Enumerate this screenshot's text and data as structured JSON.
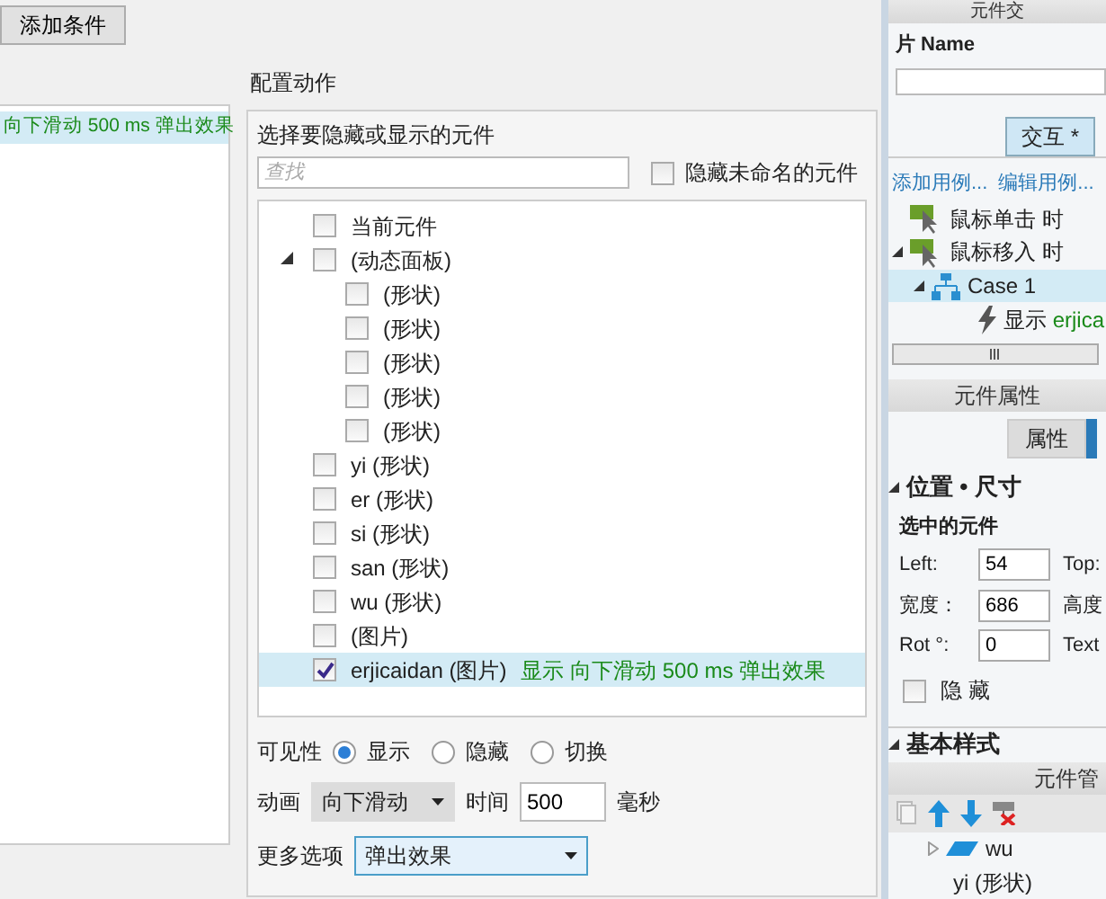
{
  "conditions_button": "添加条件",
  "case_list": {
    "rows": [
      {
        "text": "向下滑动 500 ms 弹出效果",
        "selected": true
      }
    ]
  },
  "configure": {
    "title": "配置动作",
    "group_label": "选择要隐藏或显示的元件",
    "search": {
      "placeholder": "查找"
    },
    "hide_unnamed": {
      "label": "隐藏未命名的元件",
      "checked": false
    },
    "tree": [
      {
        "label": "当前元件",
        "checked": false,
        "selected": false
      },
      {
        "label": "(动态面板)",
        "checked": false,
        "selected": false,
        "expanded": true,
        "children": [
          {
            "label": "(形状)",
            "checked": false,
            "selected": false
          },
          {
            "label": "(形状)",
            "checked": false,
            "selected": false
          },
          {
            "label": "(形状)",
            "checked": false,
            "selected": false
          },
          {
            "label": "(形状)",
            "checked": false,
            "selected": false
          },
          {
            "label": "(形状)",
            "checked": false,
            "selected": false
          }
        ]
      },
      {
        "label": "yi (形状)",
        "checked": false,
        "selected": false
      },
      {
        "label": "er (形状)",
        "checked": false,
        "selected": false
      },
      {
        "label": "si (形状)",
        "checked": false,
        "selected": false
      },
      {
        "label": "san (形状)",
        "checked": false,
        "selected": false
      },
      {
        "label": "wu (形状)",
        "checked": false,
        "selected": false
      },
      {
        "label": "(图片)",
        "checked": false,
        "selected": false
      },
      {
        "label": "erjicaidan (图片)",
        "checked": true,
        "selected": true,
        "action": "显示 向下滑动 500 ms 弹出效果"
      }
    ],
    "visibility": {
      "label": "可见性",
      "options": [
        {
          "label": "显示",
          "selected": true
        },
        {
          "label": "隐藏",
          "selected": false
        },
        {
          "label": "切换",
          "selected": false
        }
      ]
    },
    "animation": {
      "label": "动画",
      "value": "向下滑动",
      "time_label": "时间",
      "time_value": "500",
      "unit": "毫秒"
    },
    "more_options": {
      "label": "更多选项",
      "value": "弹出效果"
    }
  },
  "interactions": {
    "header": "元件交",
    "name_label": "片 Name",
    "tabs": [
      {
        "label": "交互 *",
        "selected": true
      }
    ],
    "links": [
      "添加用例...",
      "编辑用例..."
    ],
    "events": [
      {
        "label": "鼠标单击 时"
      },
      {
        "label": "鼠标移入 时",
        "expanded": true,
        "children": [
          {
            "label": "Case 1",
            "selected": true,
            "expanded": true,
            "actions": [
              {
                "verb": "显示",
                "target": "erjica"
              }
            ]
          }
        ]
      }
    ]
  },
  "properties": {
    "header": "元件属性",
    "tabs": [
      {
        "label": "属性",
        "selected": false
      }
    ],
    "section": {
      "title": "位置 • 尺寸",
      "expanded": true
    },
    "selected_label": "选中的元件",
    "fields": [
      {
        "label": "Left:",
        "value": "54",
        "label2": "Top:"
      },
      {
        "label": "宽度：",
        "value": "686",
        "label2": "高度"
      },
      {
        "label": "Rot °:",
        "value": "0",
        "label2": "Text"
      }
    ],
    "hidden": {
      "label": "隐 藏",
      "checked": false
    },
    "section2": {
      "title": "基本样式",
      "expanded": true
    }
  },
  "manager": {
    "header": "元件管",
    "tree": [
      {
        "label": "wu",
        "expanded": false
      },
      {
        "label": "yi (形状)"
      }
    ]
  }
}
